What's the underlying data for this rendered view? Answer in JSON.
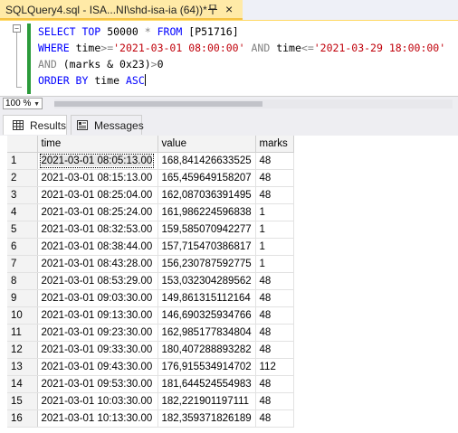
{
  "document_tab": {
    "title": "SQLQuery4.sql - ISA...NI\\shd-isa-ia (64))*",
    "close_label": "×"
  },
  "editor": {
    "line1": {
      "kw1": "SELECT TOP",
      "num": "50000",
      "star": "*",
      "kw2": "FROM",
      "table": "[P51716]"
    },
    "line2": {
      "kw1": "WHERE",
      "col1": "time",
      "op1": ">=",
      "v1": "'2021-03-01 08:00:00'",
      "kw2": "AND",
      "col2": "time",
      "op2": "<=",
      "v2": "'2021-03-29 18:00:00'"
    },
    "line3": {
      "kw1": "AND",
      "expr": "(marks & 0x23)",
      "op": ">",
      "val": "0"
    },
    "line4": {
      "kw1": "ORDER BY",
      "col": "time",
      "kw2": "ASC"
    }
  },
  "zoom": {
    "value": "100 %"
  },
  "result_tabs": [
    {
      "label": "Results",
      "icon": "grid-icon"
    },
    {
      "label": "Messages",
      "icon": "messages-icon"
    }
  ],
  "grid": {
    "columns": [
      "time",
      "value",
      "marks"
    ],
    "rows": [
      {
        "n": "1",
        "time": "2021-03-01 08:05:13.00",
        "value": "168,841426633525",
        "marks": "48"
      },
      {
        "n": "2",
        "time": "2021-03-01 08:15:13.00",
        "value": "165,459649158207",
        "marks": "48"
      },
      {
        "n": "3",
        "time": "2021-03-01 08:25:04.00",
        "value": "162,087036391495",
        "marks": "48"
      },
      {
        "n": "4",
        "time": "2021-03-01 08:25:24.00",
        "value": "161,986224596838",
        "marks": "1"
      },
      {
        "n": "5",
        "time": "2021-03-01 08:32:53.00",
        "value": "159,585070942277",
        "marks": "1"
      },
      {
        "n": "6",
        "time": "2021-03-01 08:38:44.00",
        "value": "157,715470386817",
        "marks": "1"
      },
      {
        "n": "7",
        "time": "2021-03-01 08:43:28.00",
        "value": "156,230787592775",
        "marks": "1"
      },
      {
        "n": "8",
        "time": "2021-03-01 08:53:29.00",
        "value": "153,032304289562",
        "marks": "48"
      },
      {
        "n": "9",
        "time": "2021-03-01 09:03:30.00",
        "value": "149,861315112164",
        "marks": "48"
      },
      {
        "n": "10",
        "time": "2021-03-01 09:13:30.00",
        "value": "146,690325934766",
        "marks": "48"
      },
      {
        "n": "11",
        "time": "2021-03-01 09:23:30.00",
        "value": "162,985177834804",
        "marks": "48"
      },
      {
        "n": "12",
        "time": "2021-03-01 09:33:30.00",
        "value": "180,407288893282",
        "marks": "48"
      },
      {
        "n": "13",
        "time": "2021-03-01 09:43:30.00",
        "value": "176,915534914702",
        "marks": "112"
      },
      {
        "n": "14",
        "time": "2021-03-01 09:53:30.00",
        "value": "181,644524554983",
        "marks": "48"
      },
      {
        "n": "15",
        "time": "2021-03-01 10:03:30.00",
        "value": "182,221901197111",
        "marks": "48"
      },
      {
        "n": "16",
        "time": "2021-03-01 10:13:30.00",
        "value": "182,359371826189",
        "marks": "48"
      }
    ]
  }
}
